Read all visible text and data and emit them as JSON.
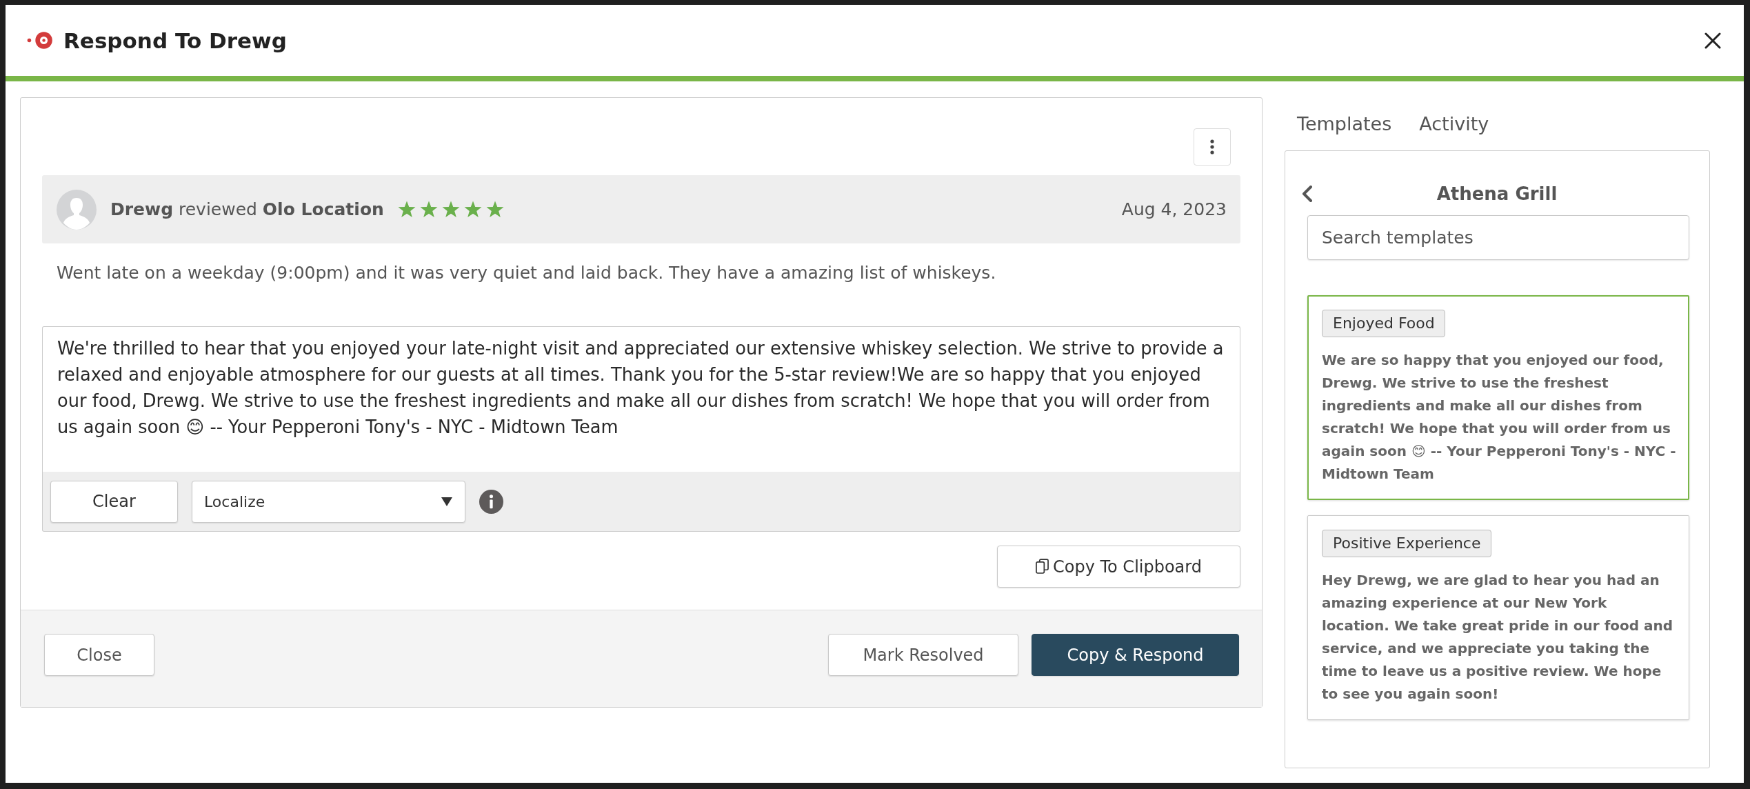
{
  "window": {
    "title": "Respond To Drewg"
  },
  "review": {
    "reviewer": "**Drewg** reviewed **Olo Location**",
    "stars": 5,
    "date": "Aug 4, 2023",
    "text": "Went late on a weekday (9:00pm) and it was very quiet and laid back. They have a amazing list of whiskeys."
  },
  "reply": {
    "value": "We're thrilled to hear that you enjoyed your late-night visit and appreciated our extensive whiskey selection. We strive to provide a relaxed and enjoyable atmosphere for our guests at all times. Thank you for the 5-star review!We are so happy that you enjoyed our food, Drewg. We strive to use the freshest ingredients and make all our dishes from scratch! We hope that you will order from us again soon 😊 -- Your Pepperoni Tony's - NYC - Midtown Team",
    "clear_button": "Clear",
    "localize": "Localize",
    "copy_button": "Copy To Clipboard"
  },
  "footer": {
    "buttons": [
      {
        "label": "Close",
        "kind": "dismiss"
      },
      {
        "label": "Mark Resolved",
        "kind": "secondary"
      },
      {
        "label": "Copy & Respond",
        "kind": "primary"
      }
    ]
  },
  "sidebar": {
    "tabs": [
      {
        "label": "Templates"
      },
      {
        "label": "Activity"
      }
    ],
    "location": "Athena Grill",
    "search": {
      "placeholder": "Search templates"
    },
    "templates": [
      {
        "tag": "Enjoyed Food",
        "text": "We are so happy that you enjoyed our food, Drewg. We strive to use the freshest ingredients and make all our dishes from scratch! We hope that you will order from us again soon 😊 -- Your Pepperoni Tony's - NYC - Midtown Team",
        "selected": true
      },
      {
        "tag": "Positive Experience",
        "text": "Hey Drewg, we are glad to hear you had an amazing experience at our New York location. We take great pride in our food and service, and we appreciate you taking the time to leave us a positive review. We hope to see you again soon!",
        "selected": false
      }
    ]
  }
}
